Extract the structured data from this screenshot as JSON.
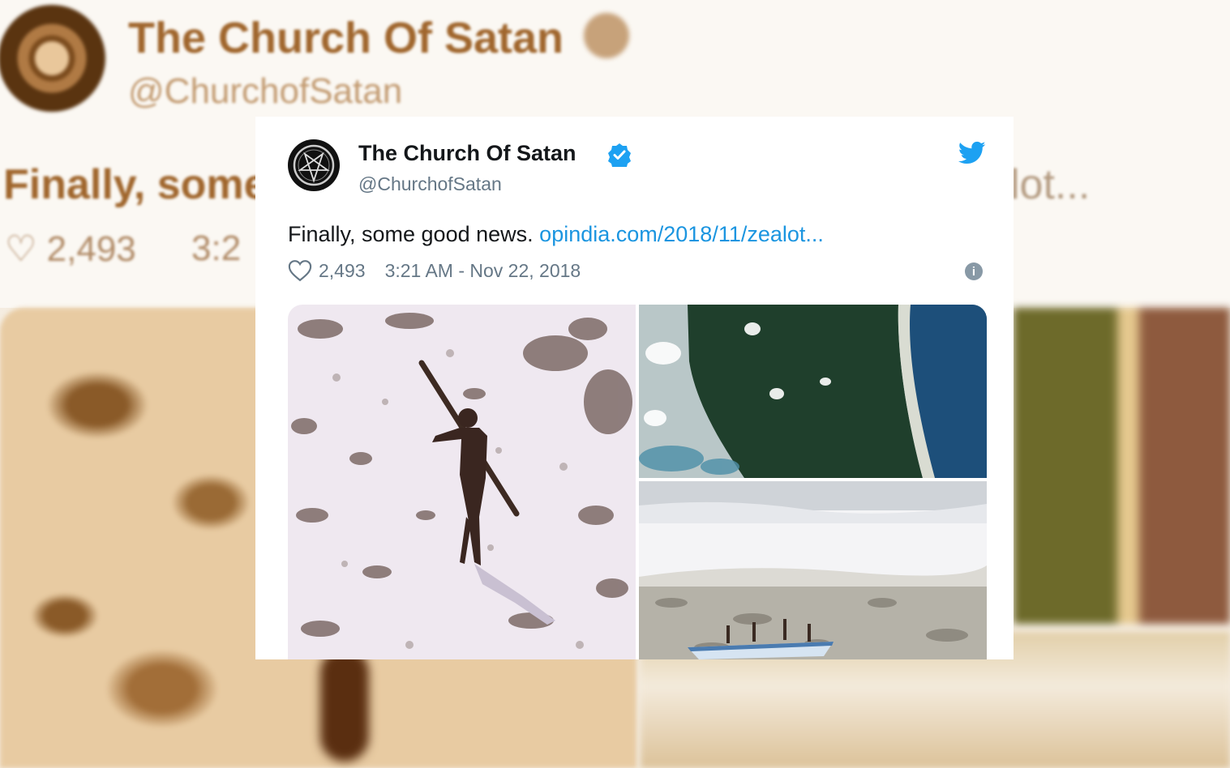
{
  "background": {
    "name": "The Church Of Satan",
    "handle": "@ChurchofSatan",
    "tweet_text_left": "Finally, some",
    "tweet_text_right": "lot...",
    "like_count": "2,493",
    "time_fragment": "3:2"
  },
  "tweet": {
    "author_name": "The Church Of Satan",
    "handle": "@ChurchofSatan",
    "text": "Finally, some good news.",
    "link_text": "opindia.com/2018/11/zealot...",
    "like_count": "2,493",
    "timestamp": "3:21 AM - Nov 22, 2018"
  },
  "icons": {
    "verified": "verified-badge-icon",
    "twitter": "twitter-bird-icon",
    "heart": "heart-icon",
    "info": "info-icon"
  },
  "colors": {
    "link": "#1b95e0",
    "verified": "#1da1f2",
    "muted": "#657786"
  }
}
